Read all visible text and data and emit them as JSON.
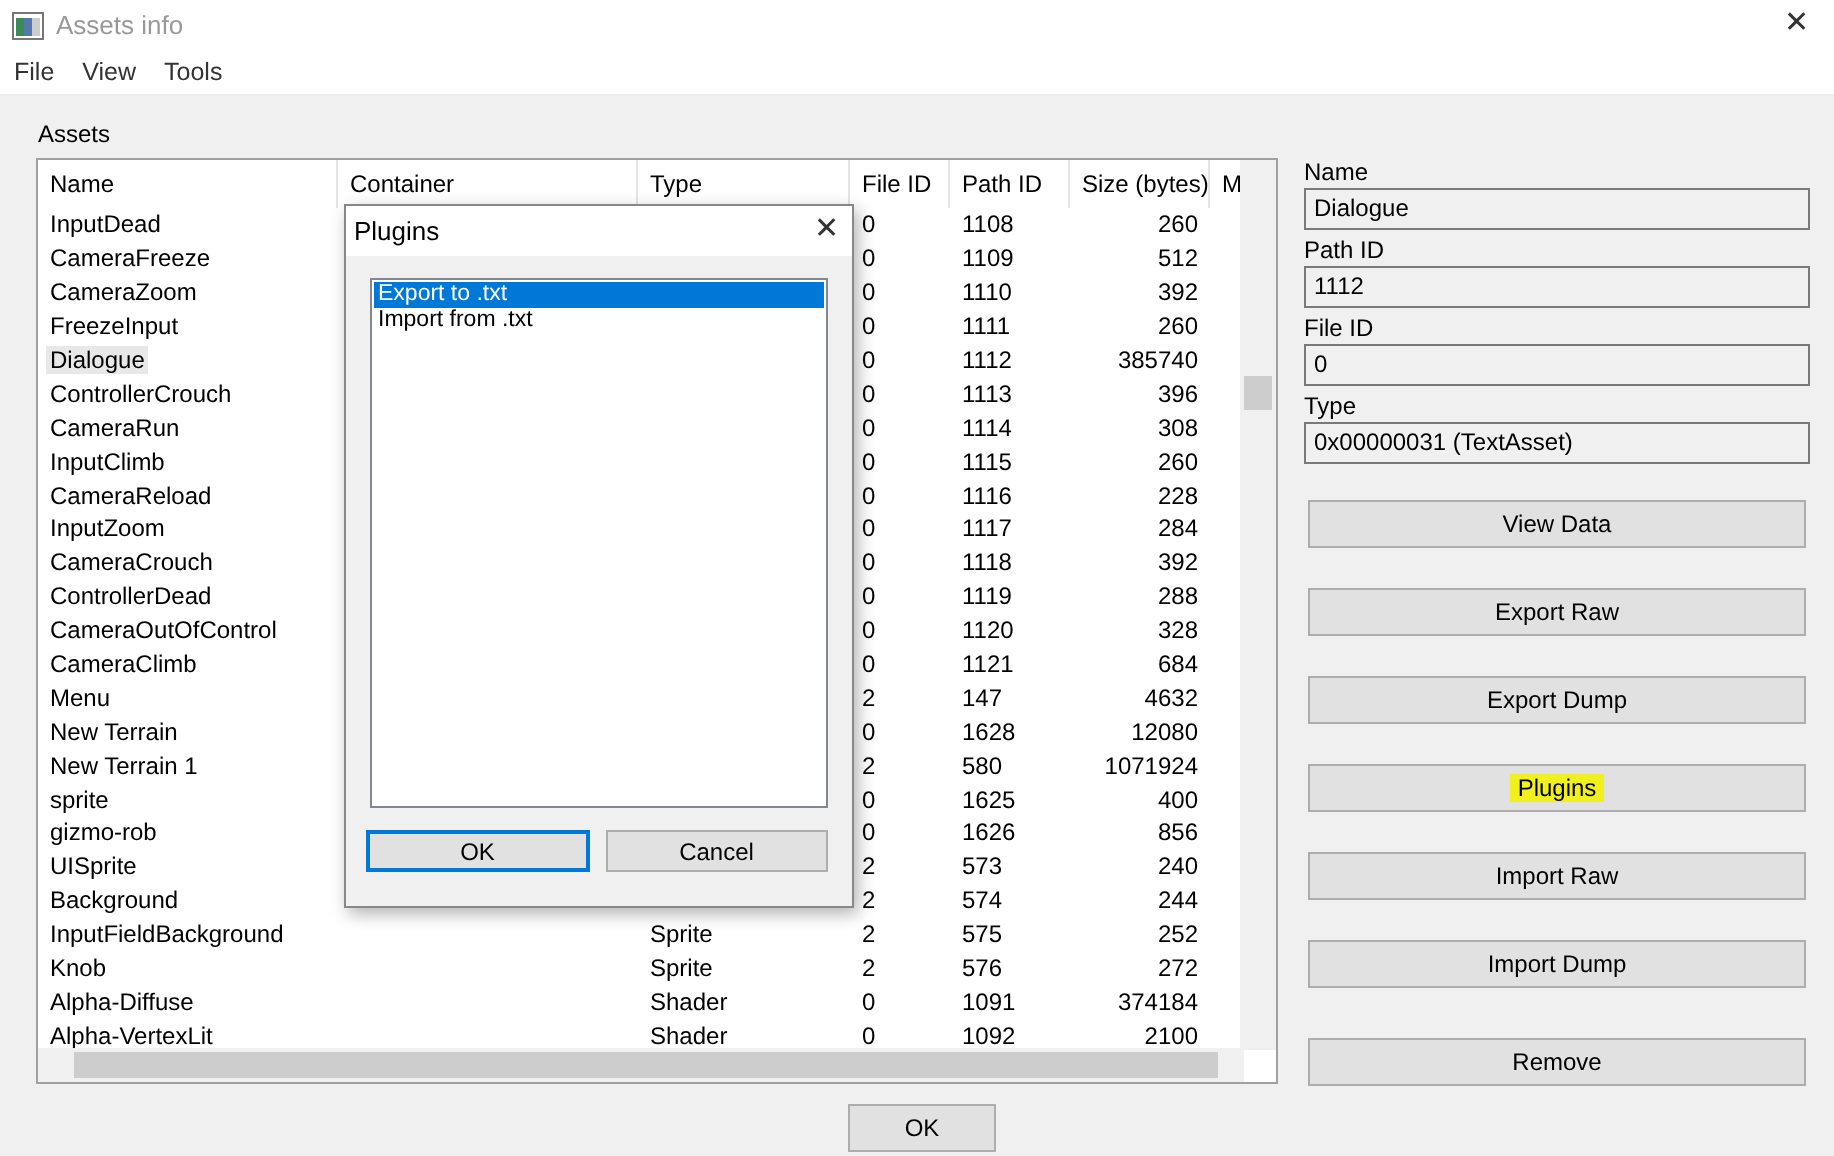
{
  "window": {
    "title": "Assets info",
    "close": "✕"
  },
  "menu": [
    "File",
    "View",
    "Tools"
  ],
  "assets": {
    "title": "Assets",
    "columns": [
      "Name",
      "Container",
      "Type",
      "File ID",
      "Path ID",
      "Size (bytes)",
      "M"
    ],
    "rows": [
      {
        "name": "InputDead",
        "file_id": "0",
        "path_id": "1108",
        "size": "260",
        "selected": false
      },
      {
        "name": "CameraFreeze",
        "file_id": "0",
        "path_id": "1109",
        "size": "512",
        "selected": false
      },
      {
        "name": "CameraZoom",
        "file_id": "0",
        "path_id": "1110",
        "size": "392",
        "selected": false
      },
      {
        "name": "FreezeInput",
        "file_id": "0",
        "path_id": "1111",
        "size": "260",
        "selected": false
      },
      {
        "name": "Dialogue",
        "file_id": "0",
        "path_id": "1112",
        "size": "385740",
        "selected": true
      },
      {
        "name": "ControllerCrouch",
        "file_id": "0",
        "path_id": "1113",
        "size": "396",
        "selected": false
      },
      {
        "name": "CameraRun",
        "file_id": "0",
        "path_id": "1114",
        "size": "308",
        "selected": false
      },
      {
        "name": "InputClimb",
        "file_id": "0",
        "path_id": "1115",
        "size": "260",
        "selected": false
      },
      {
        "name": "CameraReload",
        "file_id": "0",
        "path_id": "1116",
        "size": "228",
        "selected": false
      },
      {
        "name": "InputZoom",
        "file_id": "0",
        "path_id": "1117",
        "size": "284",
        "selected": false
      },
      {
        "name": "CameraCrouch",
        "file_id": "0",
        "path_id": "1118",
        "size": "392",
        "selected": false
      },
      {
        "name": "ControllerDead",
        "file_id": "0",
        "path_id": "1119",
        "size": "288",
        "selected": false
      },
      {
        "name": "CameraOutOfControl",
        "file_id": "0",
        "path_id": "1120",
        "size": "328",
        "selected": false
      },
      {
        "name": "CameraClimb",
        "file_id": "0",
        "path_id": "1121",
        "size": "684",
        "selected": false
      },
      {
        "name": "Menu",
        "file_id": "2",
        "path_id": "147",
        "size": "4632",
        "selected": false
      },
      {
        "name": "New Terrain",
        "file_id": "0",
        "path_id": "1628",
        "size": "12080",
        "selected": false
      },
      {
        "name": "New Terrain 1",
        "file_id": "2",
        "path_id": "580",
        "size": "1071924",
        "selected": false
      },
      {
        "name": "sprite",
        "file_id": "0",
        "path_id": "1625",
        "size": "400",
        "selected": false
      },
      {
        "name": "gizmo-rob",
        "file_id": "0",
        "path_id": "1626",
        "size": "856",
        "selected": false
      },
      {
        "name": "UISprite",
        "file_id": "2",
        "path_id": "573",
        "size": "240",
        "selected": false
      },
      {
        "name": "Background",
        "file_id": "2",
        "path_id": "574",
        "size": "244",
        "selected": false
      },
      {
        "name": "InputFieldBackground",
        "type": "Sprite",
        "file_id": "2",
        "path_id": "575",
        "size": "252",
        "selected": false
      },
      {
        "name": "Knob",
        "type": "Sprite",
        "file_id": "2",
        "path_id": "576",
        "size": "272",
        "selected": false
      },
      {
        "name": "Alpha-Diffuse",
        "type": "Shader",
        "file_id": "0",
        "path_id": "1091",
        "size": "374184",
        "selected": false
      },
      {
        "name": "Alpha-VertexLit",
        "type": "Shader",
        "file_id": "0",
        "path_id": "1092",
        "size": "2100",
        "selected": false
      }
    ]
  },
  "details": [
    {
      "label": "Name",
      "value": "Dialogue"
    },
    {
      "label": "Path ID",
      "value": "1112"
    },
    {
      "label": "File ID",
      "value": "0"
    },
    {
      "label": "Type",
      "value": "0x00000031 (TextAsset)"
    }
  ],
  "actions": [
    {
      "label": "View Data",
      "highlighted": false
    },
    {
      "label": "Export Raw",
      "highlighted": false
    },
    {
      "label": "Export Dump",
      "highlighted": false
    },
    {
      "label": "Plugins",
      "highlighted": true
    },
    {
      "label": "Import Raw",
      "highlighted": false
    },
    {
      "label": "Import Dump",
      "highlighted": false
    },
    {
      "label": "Remove",
      "highlighted": false
    }
  ],
  "ok_button": "OK",
  "dialog": {
    "title": "Plugins",
    "close": "✕",
    "items": [
      {
        "label": "Export to .txt",
        "selected": true
      },
      {
        "label": "Import from .txt",
        "selected": false
      }
    ],
    "buttons": [
      "OK",
      "Cancel"
    ]
  }
}
